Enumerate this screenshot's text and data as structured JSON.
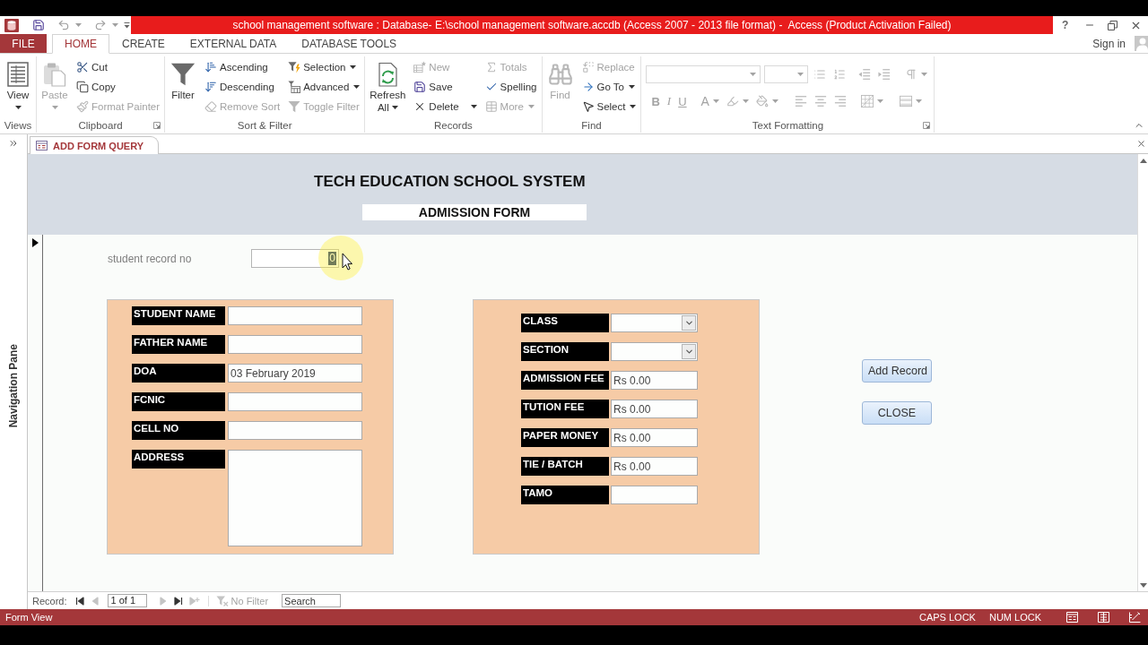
{
  "window": {
    "title": "school management software : Database- E:\\school management software.accdb (Access 2007 - 2013 file format) -  Access (Product Activation Failed)",
    "help": "?"
  },
  "ribbon_tabs": [
    {
      "label": "FILE",
      "kind": "backstage",
      "selected": false
    },
    {
      "label": "HOME",
      "kind": "tab",
      "selected": true
    },
    {
      "label": "CREATE",
      "kind": "tab",
      "selected": false
    },
    {
      "label": "EXTERNAL DATA",
      "kind": "tab",
      "selected": false
    },
    {
      "label": "DATABASE TOOLS",
      "kind": "tab",
      "selected": false
    }
  ],
  "account": {
    "label": "Sign in"
  },
  "ribbon_groups": [
    {
      "kind": "buttons",
      "label": "Views",
      "launcher": false,
      "large": [
        {
          "kind": "view",
          "label": "View",
          "dropdown": true,
          "disabled": false
        }
      ]
    },
    {
      "kind": "buttons",
      "label": "Clipboard",
      "launcher": true,
      "large": [
        {
          "kind": "paste",
          "label": "Paste",
          "dropdown": true,
          "disabled": true
        }
      ],
      "columns": [
        [
          {
            "kind": "cut",
            "label": "Cut",
            "dropdown": false,
            "disabled": false
          },
          {
            "kind": "copy",
            "label": "Copy",
            "dropdown": false,
            "disabled": false
          },
          {
            "kind": "format-painter",
            "label": "Format Painter",
            "dropdown": false,
            "disabled": true
          }
        ]
      ]
    },
    {
      "kind": "buttons",
      "label": "Sort & Filter",
      "launcher": false,
      "large": [
        {
          "kind": "filter",
          "label": "Filter",
          "dropdown": false,
          "disabled": false
        }
      ],
      "columns": [
        [
          {
            "kind": "ascending",
            "label": "Ascending",
            "dropdown": false,
            "disabled": false
          },
          {
            "kind": "descending",
            "label": "Descending",
            "dropdown": false,
            "disabled": false
          },
          {
            "kind": "remove-sort",
            "label": "Remove Sort",
            "dropdown": false,
            "disabled": true
          }
        ],
        [
          {
            "kind": "selection",
            "label": "Selection",
            "dropdown": true,
            "disabled": false
          },
          {
            "kind": "advanced",
            "label": "Advanced",
            "dropdown": true,
            "disabled": false
          },
          {
            "kind": "toggle-filter",
            "label": "Toggle Filter",
            "dropdown": false,
            "disabled": true
          }
        ]
      ]
    },
    {
      "kind": "buttons",
      "label": "Records",
      "launcher": false,
      "large": [
        {
          "kind": "refresh",
          "label": "Refresh All",
          "dropdown": true,
          "disabled": false
        }
      ],
      "columns": [
        [
          {
            "kind": "new",
            "label": "New",
            "dropdown": false,
            "disabled": true
          },
          {
            "kind": "save",
            "label": "Save",
            "dropdown": false,
            "disabled": false
          },
          {
            "kind": "delete",
            "label": "Delete",
            "dropdown": true,
            "disabled": false
          }
        ],
        [
          {
            "kind": "totals",
            "label": "Totals",
            "dropdown": false,
            "disabled": true
          },
          {
            "kind": "spelling",
            "label": "Spelling",
            "dropdown": false,
            "disabled": false
          },
          {
            "kind": "more",
            "label": "More",
            "dropdown": true,
            "disabled": true
          }
        ]
      ]
    },
    {
      "kind": "buttons",
      "label": "Find",
      "launcher": false,
      "large": [
        {
          "kind": "find",
          "label": "Find",
          "dropdown": false,
          "disabled": true
        }
      ],
      "columns": [
        [
          {
            "kind": "replace",
            "label": "Replace",
            "dropdown": false,
            "disabled": true
          },
          {
            "kind": "go-to",
            "label": "Go To",
            "dropdown": true,
            "disabled": false
          },
          {
            "kind": "select",
            "label": "Select",
            "dropdown": true,
            "disabled": false
          }
        ]
      ]
    },
    {
      "kind": "formatting",
      "label": "Text Formatting",
      "launcher": true,
      "rows": [
        [
          {
            "kind": "font-name",
            "dropdown": true,
            "disabled": true
          },
          {
            "kind": "font-size",
            "dropdown": true,
            "disabled": true
          },
          {
            "kind": "bullets",
            "dropdown": false,
            "disabled": true
          },
          {
            "kind": "numbering",
            "dropdown": false,
            "disabled": true
          },
          {
            "kind": "outdent",
            "dropdown": false,
            "disabled": true
          },
          {
            "kind": "indent",
            "dropdown": false,
            "disabled": true
          },
          {
            "kind": "paragraph",
            "dropdown": true,
            "disabled": true
          }
        ],
        [
          {
            "kind": "bold",
            "label": "B",
            "dropdown": false,
            "disabled": true
          },
          {
            "kind": "italic",
            "label": "I",
            "dropdown": false,
            "disabled": true
          },
          {
            "kind": "underline",
            "label": "U",
            "dropdown": false,
            "disabled": true
          },
          {
            "kind": "font-color",
            "label": "A",
            "dropdown": true,
            "disabled": true
          },
          {
            "kind": "highlight",
            "dropdown": true,
            "disabled": true
          },
          {
            "kind": "fill-color",
            "dropdown": true,
            "disabled": true
          },
          {
            "kind": "align-left",
            "dropdown": false,
            "disabled": true
          },
          {
            "kind": "align-center",
            "dropdown": false,
            "disabled": true
          },
          {
            "kind": "align-right",
            "dropdown": false,
            "disabled": true
          },
          {
            "kind": "gridlines",
            "dropdown": true,
            "disabled": true
          },
          {
            "kind": "alternate-row",
            "dropdown": true,
            "disabled": true
          }
        ]
      ]
    }
  ],
  "navigation_pane": {
    "label": "Navigation Pane"
  },
  "document_tabs": [
    {
      "label": "ADD FORM QUERY",
      "selected": true
    }
  ],
  "form": {
    "title": "TECH EDUCATION SCHOOL SYSTEM",
    "subtitle": "ADMISSION FORM",
    "record_no": {
      "label": "student record no",
      "value": "0",
      "text_selected": true
    },
    "student_fields": [
      {
        "label": "STUDENT NAME",
        "kind": "text"
      },
      {
        "label": "FATHER NAME",
        "kind": "text"
      },
      {
        "label": "DOA",
        "kind": "text",
        "value": "03 February 2019"
      },
      {
        "label": "FCNIC",
        "kind": "text"
      },
      {
        "label": "CELL NO",
        "kind": "text"
      },
      {
        "label": "ADDRESS",
        "kind": "memo"
      }
    ],
    "fee_fields": [
      {
        "label": "CLASS",
        "kind": "combo"
      },
      {
        "label": "SECTION",
        "kind": "combo"
      },
      {
        "label": "ADMISSION FEE",
        "kind": "text",
        "value": "Rs 0.00"
      },
      {
        "label": "TUTION FEE",
        "kind": "text",
        "value": "Rs 0.00"
      },
      {
        "label": "PAPER MONEY",
        "kind": "text",
        "value": "Rs 0.00"
      },
      {
        "label": "TIE / BATCH",
        "kind": "text",
        "value": "Rs 0.00"
      },
      {
        "label": "TAMO",
        "kind": "text"
      }
    ],
    "buttons": [
      {
        "label": "Add Record"
      },
      {
        "label": "CLOSE"
      }
    ]
  },
  "record_navigation": {
    "label": "Record:",
    "position": "1 of 1",
    "buttons": [
      {
        "kind": "first",
        "disabled": false
      },
      {
        "kind": "previous",
        "disabled": true
      },
      {
        "kind": "next",
        "disabled": true
      },
      {
        "kind": "last",
        "disabled": false
      },
      {
        "kind": "new",
        "disabled": true
      }
    ],
    "filter": {
      "label": "No Filter",
      "disabled": true
    },
    "search": {
      "placeholder": "Search"
    }
  },
  "status_bar": {
    "mode": "Form View",
    "indicators": [
      "CAPS LOCK",
      "NUM LOCK"
    ]
  }
}
